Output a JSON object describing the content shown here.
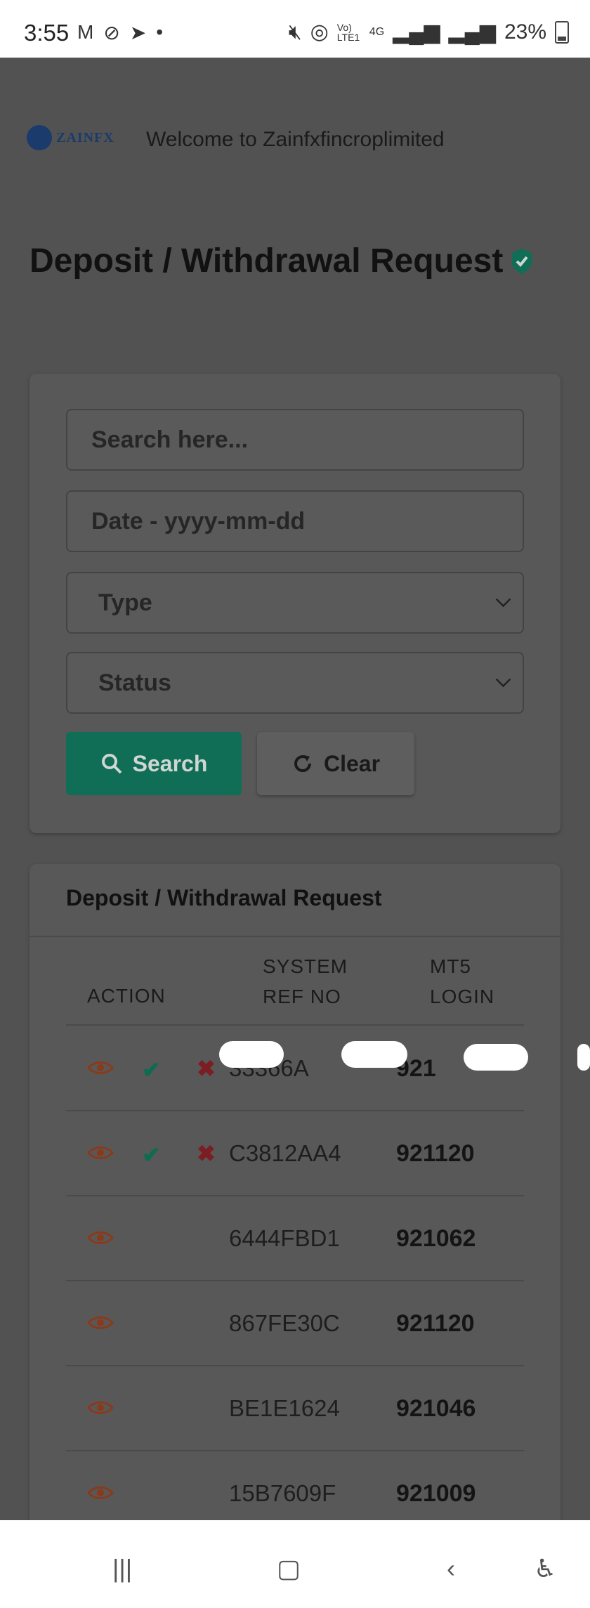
{
  "status_bar": {
    "time": "3:55",
    "battery": "23%",
    "network": "4G",
    "volte": "Vo) LTE1"
  },
  "header": {
    "logo_text": "ZAINFX",
    "welcome": "Welcome to Zainfxfincroplimited"
  },
  "page": {
    "title": "Deposit / Withdrawal Request"
  },
  "filters": {
    "search_placeholder": "Search  here...",
    "date_placeholder": "Date - yyyy-mm-dd",
    "type_label": "Type",
    "status_label": "Status",
    "search_button": "Search",
    "clear_button": "Clear"
  },
  "table": {
    "title": "Deposit / Withdrawal Request",
    "headers": {
      "action": "ACTION",
      "ref_line1": "SYSTEM",
      "ref_line2": "REF NO",
      "login_line1": "MT5",
      "login_line2": "LOGIN"
    },
    "rows": [
      {
        "ref": "33366A",
        "login": "921",
        "approve": true
      },
      {
        "ref": "C3812AA4",
        "login": "921120",
        "approve": true
      },
      {
        "ref": "6444FBD1",
        "login": "921062",
        "approve": false
      },
      {
        "ref": "867FE30C",
        "login": "921120",
        "approve": false
      },
      {
        "ref": "BE1E1624",
        "login": "921046",
        "approve": false
      },
      {
        "ref": "15B7609F",
        "login": "921009",
        "approve": false
      }
    ]
  },
  "colors": {
    "accent": "#0f6e55",
    "eye": "#8a3a1a",
    "approve": "#0d6b4f",
    "reject": "#7b1e24"
  },
  "icons": {
    "eye": "eye-icon",
    "approve": "check-icon",
    "reject": "cross-icon",
    "search": "search-icon",
    "clear": "refresh-icon",
    "verified": "shield-check-icon"
  }
}
